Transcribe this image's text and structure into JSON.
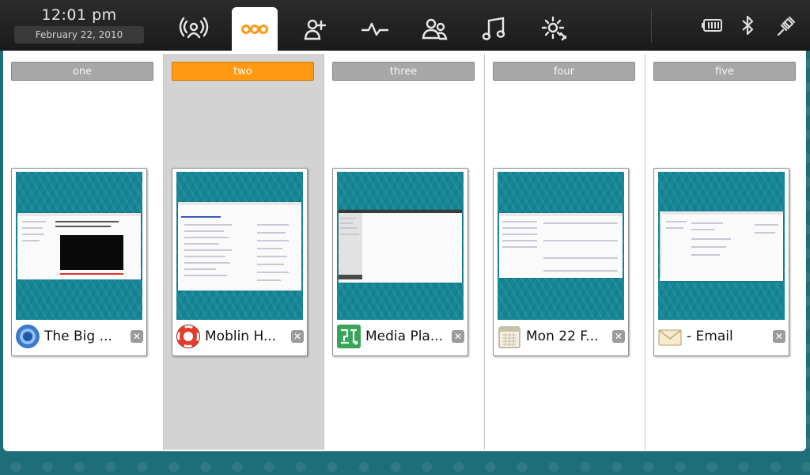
{
  "clock": {
    "time": "12:01 pm",
    "date": "February 22, 2010"
  },
  "toolbar": {
    "icons": [
      "status-icon",
      "zones-icon",
      "people-icon",
      "activity-icon",
      "contacts-icon",
      "music-icon",
      "applications-icon"
    ],
    "active": "zones-icon",
    "status_icons": [
      "battery-icon",
      "bluetooth-icon",
      "network-icon"
    ]
  },
  "colors": {
    "accent": "#ff9a12",
    "wallpaper": "#158797",
    "topbar": "#1e1e1e"
  },
  "zones": [
    {
      "label": "one",
      "active": false,
      "window": {
        "title": "The Big ...",
        "icon": "chromium-icon"
      }
    },
    {
      "label": "two",
      "active": true,
      "window": {
        "title": "Moblin H...",
        "icon": "help-icon"
      }
    },
    {
      "label": "three",
      "active": false,
      "window": {
        "title": "Media Pla...",
        "icon": "media-player-icon"
      }
    },
    {
      "label": "four",
      "active": false,
      "window": {
        "title": "Mon 22 F...",
        "icon": "calendar-icon"
      }
    },
    {
      "label": "five",
      "active": false,
      "window": {
        "title": "- Email",
        "icon": "email-icon"
      }
    }
  ],
  "close_glyph": "✕"
}
